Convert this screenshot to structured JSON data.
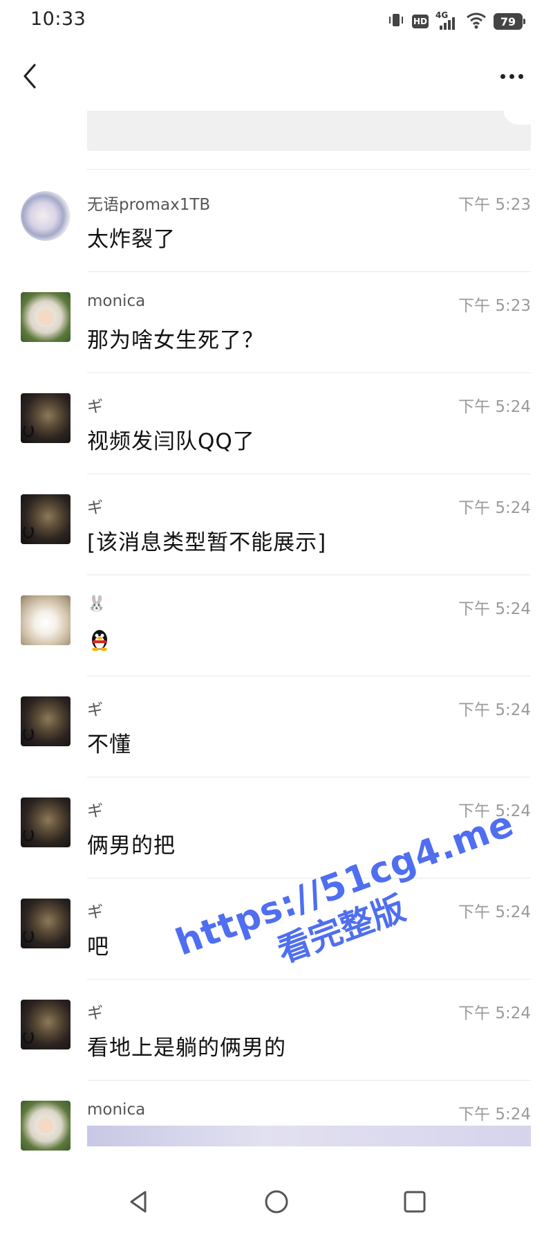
{
  "status_bar": {
    "time": "10:33",
    "network_label": "4G",
    "hd_label": "HD",
    "battery": "79"
  },
  "messages": [
    {
      "sender": "无语promax1TB",
      "time": "下午 5:23",
      "text": "太炸裂了",
      "avatar": "wuyu"
    },
    {
      "sender": "monica",
      "time": "下午 5:23",
      "text": "那为啥女生死了？",
      "avatar": "monica"
    },
    {
      "sender": "ギ",
      "time": "下午 5:24",
      "text": "视频发闫队QQ了",
      "avatar": "dark"
    },
    {
      "sender": "ギ",
      "time": "下午 5:24",
      "text": "[该消息类型暂不能展示]",
      "avatar": "dark"
    },
    {
      "sender": "🐰",
      "time": "下午 5:24",
      "text": "",
      "avatar": "rabbit",
      "sticker": "qq-penguin-icon"
    },
    {
      "sender": "ギ",
      "time": "下午 5:24",
      "text": "不懂",
      "avatar": "dark"
    },
    {
      "sender": "ギ",
      "time": "下午 5:24",
      "text": "俩男的把",
      "avatar": "dark"
    },
    {
      "sender": "ギ",
      "time": "下午 5:24",
      "text": "吧",
      "avatar": "dark"
    },
    {
      "sender": "ギ",
      "time": "下午 5:24",
      "text": "看地上是躺的俩男的",
      "avatar": "dark"
    },
    {
      "sender": "monica",
      "time": "下午 5:24",
      "text": "",
      "avatar": "monica",
      "partial_image": true
    }
  ],
  "watermark": {
    "url": "https://51cg4.me",
    "cta": "看完整版",
    "color": "#4f6ef0"
  },
  "colors": {
    "background": "#ffffff",
    "divider": "#e8e8e8",
    "time_text": "#9a9a9a"
  }
}
